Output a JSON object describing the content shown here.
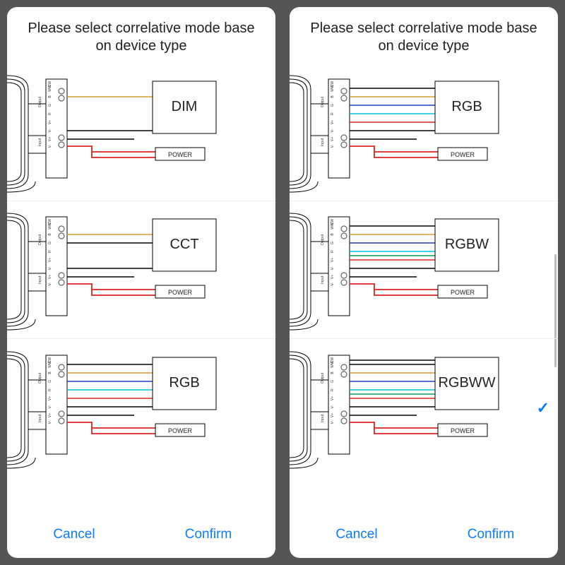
{
  "header": {
    "title": "Please select correlative mode base on device type"
  },
  "footer": {
    "cancel": "Cancel",
    "confirm": "Confirm"
  },
  "wiring_labels": {
    "output": "Output",
    "input": "Input",
    "power": "POWER",
    "terminals": [
      "V-",
      "V+",
      "V-",
      "V+",
      "R",
      "G",
      "B",
      "WW",
      "CW"
    ]
  },
  "screens": [
    {
      "options": [
        "DIM",
        "CCT",
        "RGB"
      ],
      "selected": null
    },
    {
      "options": [
        "RGB",
        "RGBW",
        "RGBWW"
      ],
      "selected": "RGBWW"
    }
  ],
  "colors": {
    "black": "#000000",
    "red": "#d22",
    "green": "#0c9b5b",
    "blue": "#1e3fbf",
    "cyan": "#00c4dc",
    "warm": "#d69a2b",
    "cool": "#7aa8d6"
  }
}
